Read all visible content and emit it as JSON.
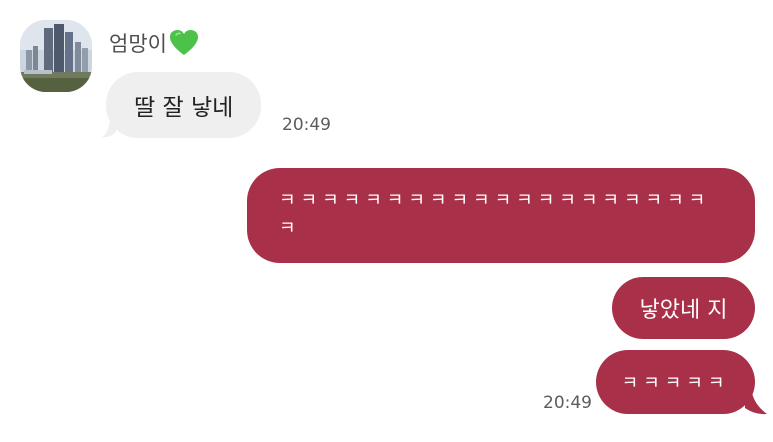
{
  "contact": {
    "name": "엄망이",
    "badge_icon": "green-heart-icon",
    "avatar_icon": "city-skyline-photo"
  },
  "messages": [
    {
      "direction": "in",
      "text": "딸 잘 낳네",
      "time": "20:49"
    },
    {
      "direction": "out",
      "text": "ㅋㅋㅋㅋㅋㅋㅋㅋㅋㅋㅋㅋㅋㅋㅋㅋㅋㅋㅋㅋㅋ"
    },
    {
      "direction": "out",
      "text": "낳았네 지"
    },
    {
      "direction": "out",
      "text": "ㅋㅋㅋㅋㅋ",
      "time": "20:49"
    }
  ],
  "colors": {
    "outgoing_bubble": "#a83048",
    "incoming_bubble": "#efefef",
    "heart": "#4cc24a"
  }
}
